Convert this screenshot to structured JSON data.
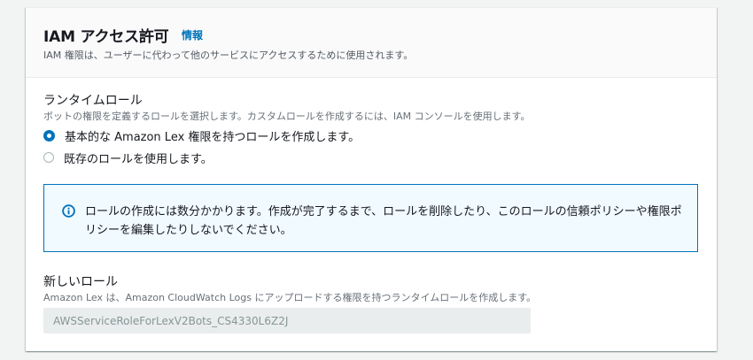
{
  "panel": {
    "title": "IAM アクセス許可",
    "info_link": "情報",
    "description": "IAM 権限は、ユーザーに代わって他のサービスにアクセスするために使用されます。"
  },
  "runtime_role": {
    "label": "ランタイムロール",
    "description": "ボットの権限を定義するロールを選択します。カスタムロールを作成するには、IAM コンソールを使用します。",
    "options": [
      {
        "label": "基本的な Amazon Lex 権限を持つロールを作成します。",
        "selected": true
      },
      {
        "label": "既存のロールを使用します。",
        "selected": false
      }
    ]
  },
  "alert": {
    "icon": "info-circle-icon",
    "text": "ロールの作成には数分かかります。作成が完了するまで、ロールを削除したり、このロールの信頼ポリシーや権限ポリシーを編集したりしないでください。"
  },
  "new_role": {
    "label": "新しいロール",
    "description": "Amazon Lex は、Amazon CloudWatch Logs にアップロードする権限を持つランタイムロールを作成します。",
    "value": "AWSServiceRoleForLexV2Bots_CS4330L6Z2J"
  },
  "colors": {
    "accent": "#0073bb",
    "alert_background": "#f1faff"
  }
}
